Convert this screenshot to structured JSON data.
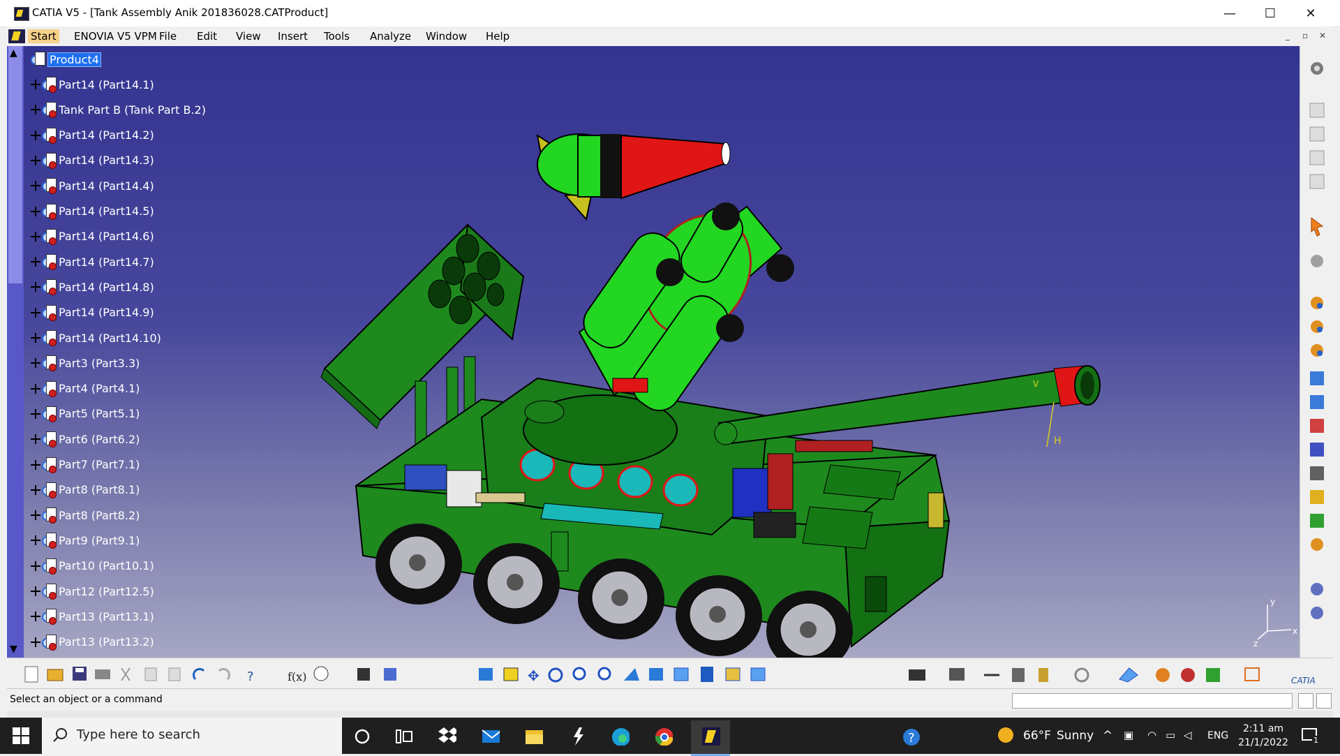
{
  "window": {
    "title": "CATIA V5 - [Tank Assembly Anik 201836028.CATProduct]",
    "minimize": "—",
    "maximize": "☐",
    "close": "✕"
  },
  "menubar": {
    "items": [
      "Start",
      "ENOVIA V5 VPM",
      "File",
      "Edit",
      "View",
      "Insert",
      "Tools",
      "Analyze",
      "Window",
      "Help"
    ],
    "active": "Start"
  },
  "tree": {
    "root": "Product4",
    "nodes": [
      "Part14 (Part14.1)",
      "Tank Part B (Tank Part B.2)",
      "Part14 (Part14.2)",
      "Part14 (Part14.3)",
      "Part14 (Part14.4)",
      "Part14 (Part14.5)",
      "Part14 (Part14.6)",
      "Part14 (Part14.7)",
      "Part14 (Part14.8)",
      "Part14 (Part14.9)",
      "Part14 (Part14.10)",
      "Part3 (Part3.3)",
      "Part4 (Part4.1)",
      "Part5 (Part5.1)",
      "Part6 (Part6.2)",
      "Part7 (Part7.1)",
      "Part8 (Part8.1)",
      "Part8 (Part8.2)",
      "Part9 (Part9.1)",
      "Part10 (Part10.1)",
      "Part12 (Part12.5)",
      "Part13 (Part13.1)",
      "Part13 (Part13.2)"
    ]
  },
  "viewport": {
    "compass_labels": {
      "x": "x",
      "y": "y",
      "z": "z"
    },
    "gun_labels": {
      "v": "V",
      "h": "H"
    }
  },
  "colors": {
    "tank_green": "#1e8a1e",
    "bright_green": "#22d622",
    "red": "#e01515",
    "cyan": "#1ab8b8",
    "selection": "#1e6ff0"
  },
  "status": {
    "message": "Select an object or a command"
  },
  "taskbar": {
    "search_placeholder": "Type here to search",
    "weather_temp": "66°F",
    "weather_text": "Sunny",
    "language": "ENG",
    "time": "2:11 am",
    "date": "21/1/2022",
    "notification_count": "1"
  }
}
